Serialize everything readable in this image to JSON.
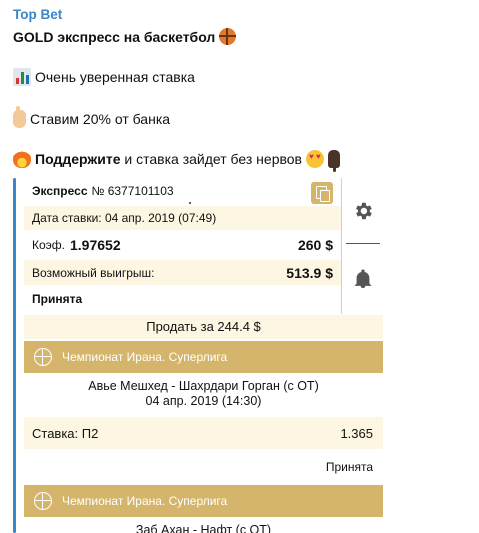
{
  "channel": {
    "name": "Top Bet"
  },
  "message": {
    "line1": "GOLD экспресс на баскетбол",
    "line2": "Очень уверенная ставка",
    "line3": "Ставим 20% от банка",
    "line4_bold": "Поддержите",
    "line4_rest": " и ставка зайдет без нервов"
  },
  "bet": {
    "type_label": "Экспресс",
    "number": "№ 6377101103",
    "date": "Дата ставки: 04 апр. 2019 (07:49)",
    "coef_label": "Коэф.",
    "coef_value": "1.97652",
    "stake_amount": "260 $",
    "win_label": "Возможный выигрыш:",
    "win_amount": "513.9 $",
    "status": "Принята",
    "sell_label": "Продать за 244.4 $"
  },
  "events": [
    {
      "league": "Чемпионат Ирана. Суперлига",
      "match": "Авье Мешхед - Шахрдари Горган (с ОТ)",
      "date": "04 апр. 2019 (14:30)",
      "stake_label": "Ставка: П2",
      "stake_coef": "1.365",
      "status": "Принята"
    },
    {
      "league": "Чемпионат Ирана. Суперлига",
      "match": "Заб Ахан - Нафт (с ОТ)"
    }
  ],
  "colors": {
    "accent": "#3a86c8",
    "gold": "#d4b56b",
    "cream": "#fdf6e2"
  },
  "icons": [
    "basketball-icon",
    "chart-icon",
    "hand-icon",
    "fire-icon",
    "heart-eyes-icon",
    "thumbs-down-icon",
    "copy-icon",
    "gear-icon",
    "bell-icon"
  ]
}
